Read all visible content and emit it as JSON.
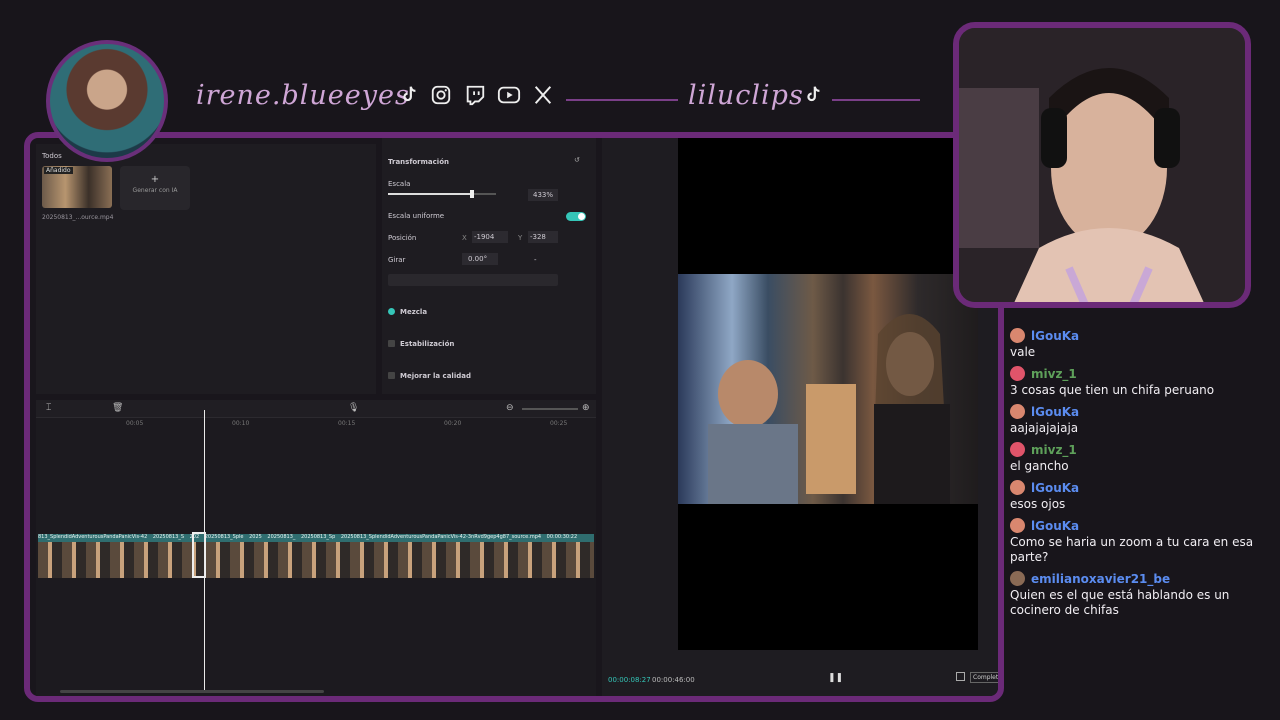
{
  "header": {
    "handle_main": "irene.blueeyes",
    "handle_secondary": "liluclips",
    "social_icons": [
      "tiktok-icon",
      "instagram-icon",
      "twitch-icon",
      "youtube-icon",
      "x-icon"
    ]
  },
  "media_panel": {
    "filter_label": "Todos",
    "added_badge": "Añadido",
    "clip_name": "20250813_...ource.mp4",
    "generate_label": "Generar con IA"
  },
  "properties": {
    "transform_title": "Transformación",
    "scale_label": "Escala",
    "scale_value": "433%",
    "scale_fraction": 0.78,
    "uniform_scale_label": "Escala uniforme",
    "position_label": "Posición",
    "pos_x_label": "X",
    "pos_x_value": "-1904",
    "pos_y_label": "Y",
    "pos_y_value": "-328",
    "rotate_label": "Girar",
    "rotate_value": "0.00°",
    "rotate_dash": "-",
    "blend_label": "Mezcla",
    "stabilize_label": "Estabilización",
    "enhance_label": "Mejorar la calidad"
  },
  "timeline": {
    "ticks": [
      "00:05",
      "00:10",
      "00:15",
      "00:20",
      "00:25"
    ],
    "clip_labels": [
      "813_SplendidAdventurousPandaPanicVis-42",
      "20250813_S",
      "202",
      "20250813_Sple",
      "2025",
      "20250813_",
      "20250813_Sp",
      "20250813_SplendidAdventurousPandaPanicVis-42-3nRvd9gep4g87_source.mp4",
      "00:00:30:22"
    ]
  },
  "player": {
    "current_time": "00:00:08:27",
    "total_time": "00:00:46:00",
    "complete_label": "Completa"
  },
  "chat": [
    {
      "user": "lGouKa",
      "color": "#5b8cf0",
      "badge": "#d9876f",
      "text": "vale"
    },
    {
      "user": "mivz_1",
      "color": "#5ea05a",
      "badge": "#e0546a",
      "text": "3 cosas que tien un chifa peruano"
    },
    {
      "user": "lGouKa",
      "color": "#5b8cf0",
      "badge": "#d9876f",
      "text": "aajajajajaja"
    },
    {
      "user": "mivz_1",
      "color": "#5ea05a",
      "badge": "#e0546a",
      "text": "el gancho"
    },
    {
      "user": "lGouKa",
      "color": "#5b8cf0",
      "badge": "#d9876f",
      "text": "esos ojos"
    },
    {
      "user": "lGouKa",
      "color": "#5b8cf0",
      "badge": "#d9876f",
      "text": "Como se haria un zoom a tu cara en esa parte?"
    },
    {
      "user": "emilianoxavier21_be",
      "color": "#5b8cf0",
      "badge": "#8a6a55",
      "text": "Quien es el que está hablando es un cocinero de chifas"
    }
  ]
}
